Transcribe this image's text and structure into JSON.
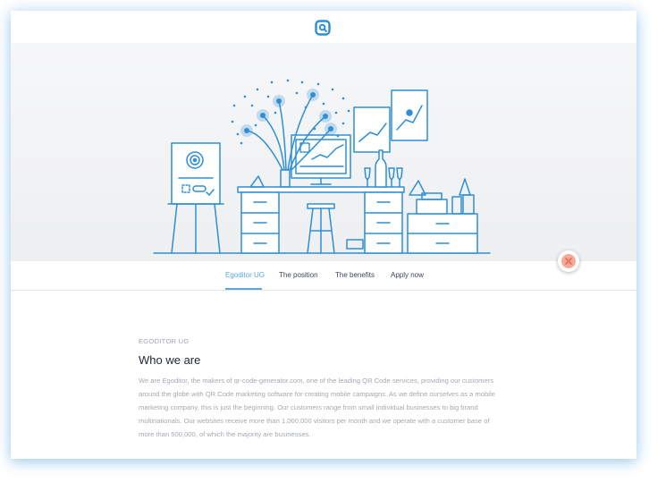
{
  "nav": {
    "tabs": [
      {
        "label": "Egoditor UG",
        "active": true
      },
      {
        "label": "The position",
        "active": false
      },
      {
        "label": "The benefits",
        "active": false
      },
      {
        "label": "Apply now",
        "active": false
      }
    ]
  },
  "colors": {
    "accent": "#59a9dc",
    "illustration": "#2e8fd6",
    "close_button": "#f6a999"
  },
  "content": {
    "eyebrow": "EGODITOR UG",
    "heading": "Who we are",
    "paragraph": "We are Egoditor, the makers of qr-code-generator.com, one of the leading QR Code services, providing our customers around the globe with QR Code marketing software for creating mobile campaigns. As we define ourselves as a mobile marketing company, this is just the beginning. Our customers range from small individual businesses to big brand multinationals. Our websites receive more than 1,000,000 visitors per month and we operate with a customer base of more than 500,000, of which the majority are businesses."
  },
  "icons": {
    "logo": "egoditor-logo-icon",
    "close": "close-icon",
    "hero": "office-desk-illustration"
  }
}
